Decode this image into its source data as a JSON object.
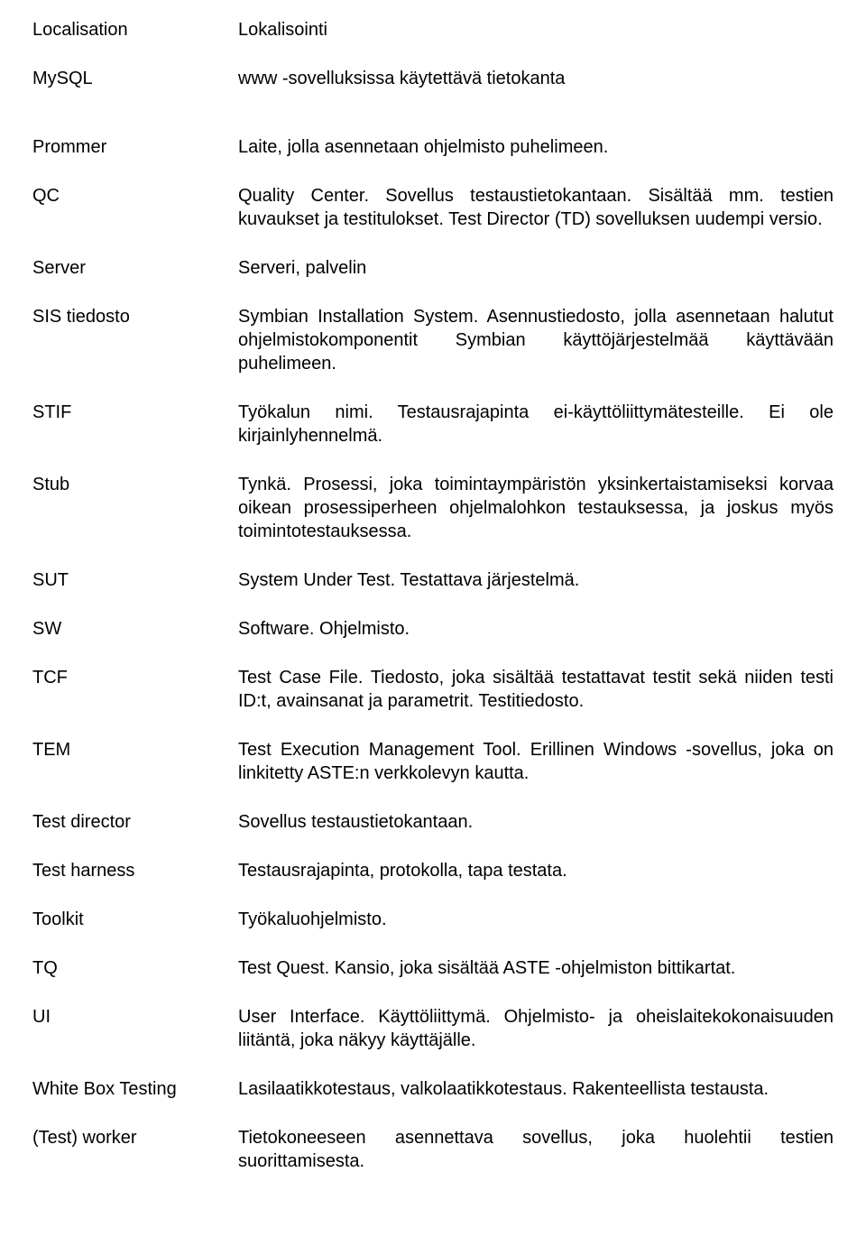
{
  "entries": [
    {
      "term": "Localisation",
      "def": "Lokalisointi",
      "justify": false,
      "gap": false
    },
    {
      "term": "MySQL",
      "def": "www -sovelluksissa käytettävä tietokanta",
      "justify": false,
      "gap": true
    },
    {
      "term": "Prommer",
      "def": "Laite, jolla asennetaan ohjelmisto puhelimeen.",
      "justify": false,
      "gap": false
    },
    {
      "term": "QC",
      "def": "Quality Center. Sovellus testaustietokantaan. Sisältää mm. testien kuvaukset ja testitulokset. Test Director (TD) sovelluksen uudempi versio.",
      "justify": true,
      "gap": false
    },
    {
      "term": "Server",
      "def": "Serveri, palvelin",
      "justify": false,
      "gap": false
    },
    {
      "term": "SIS tiedosto",
      "def": "Symbian Installation System. Asennustiedosto, jolla asennetaan halutut ohjelmistokomponentit Symbian käyttöjärjestelmää käyttävään puhelimeen.",
      "justify": true,
      "gap": false
    },
    {
      "term": "STIF",
      "def": "Työkalun nimi. Testausrajapinta ei-käyttöliittymätesteille. Ei ole kirjainlyhennelmä.",
      "justify": true,
      "gap": false
    },
    {
      "term": "Stub",
      "def": "Tynkä. Prosessi, joka toimintaympäristön yksinkertaistamiseksi korvaa oikean prosessiperheen ohjelmalohkon testauksessa, ja joskus myös toimintotestauksessa.",
      "justify": true,
      "gap": false
    },
    {
      "term": "SUT",
      "def": "System Under Test. Testattava järjestelmä.",
      "justify": false,
      "gap": false
    },
    {
      "term": "SW",
      "def": "Software. Ohjelmisto.",
      "justify": false,
      "gap": false
    },
    {
      "term": "TCF",
      "def": "Test Case File. Tiedosto, joka sisältää testattavat testit sekä niiden testi ID:t, avainsanat ja parametrit. Testitiedosto.",
      "justify": true,
      "gap": false
    },
    {
      "term": "TEM",
      "def": "Test Execution Management Tool. Erillinen Windows -sovellus, joka on linkitetty ASTE:n verkkolevyn kautta.",
      "justify": true,
      "gap": false
    },
    {
      "term": "Test director",
      "def": "Sovellus testaustietokantaan.",
      "justify": false,
      "gap": false
    },
    {
      "term": "Test harness",
      "def": "Testausrajapinta, protokolla, tapa testata.",
      "justify": false,
      "gap": false
    },
    {
      "term": "Toolkit",
      "def": "Työkaluohjelmisto.",
      "justify": false,
      "gap": false
    },
    {
      "term": "TQ",
      "def": "Test Quest. Kansio, joka sisältää ASTE -ohjelmiston bittikartat.",
      "justify": false,
      "gap": false
    },
    {
      "term": "UI",
      "def": "User Interface. Käyttöliittymä. Ohjelmisto- ja oheislaitekokonaisuuden liitäntä, joka näkyy käyttäjälle.",
      "justify": true,
      "gap": false
    },
    {
      "term": "White Box Testing",
      "def": "Lasilaatikkotestaus, valkolaatikkotestaus. Rakenteellista testausta.",
      "justify": true,
      "gap": false
    },
    {
      "term": "(Test) worker",
      "def": "Tietokoneeseen asennettava sovellus, joka huolehtii testien suorittamisesta.",
      "justify": true,
      "gap": false
    }
  ]
}
